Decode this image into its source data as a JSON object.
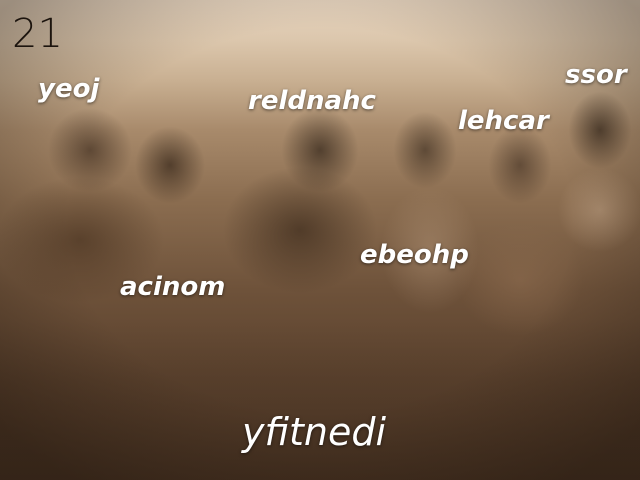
{
  "counter": "21",
  "words": {
    "yeoj": "yeoj",
    "reldnahc": "reldnahc",
    "ssor": "ssor",
    "lehcar": "lehcar",
    "ebeohp": "ebeohp",
    "acinom": "acinom"
  },
  "target_word": "yfitnedi",
  "colors": {
    "text": "#ffffff",
    "counter": "#1c140e",
    "tint": "sepia"
  }
}
